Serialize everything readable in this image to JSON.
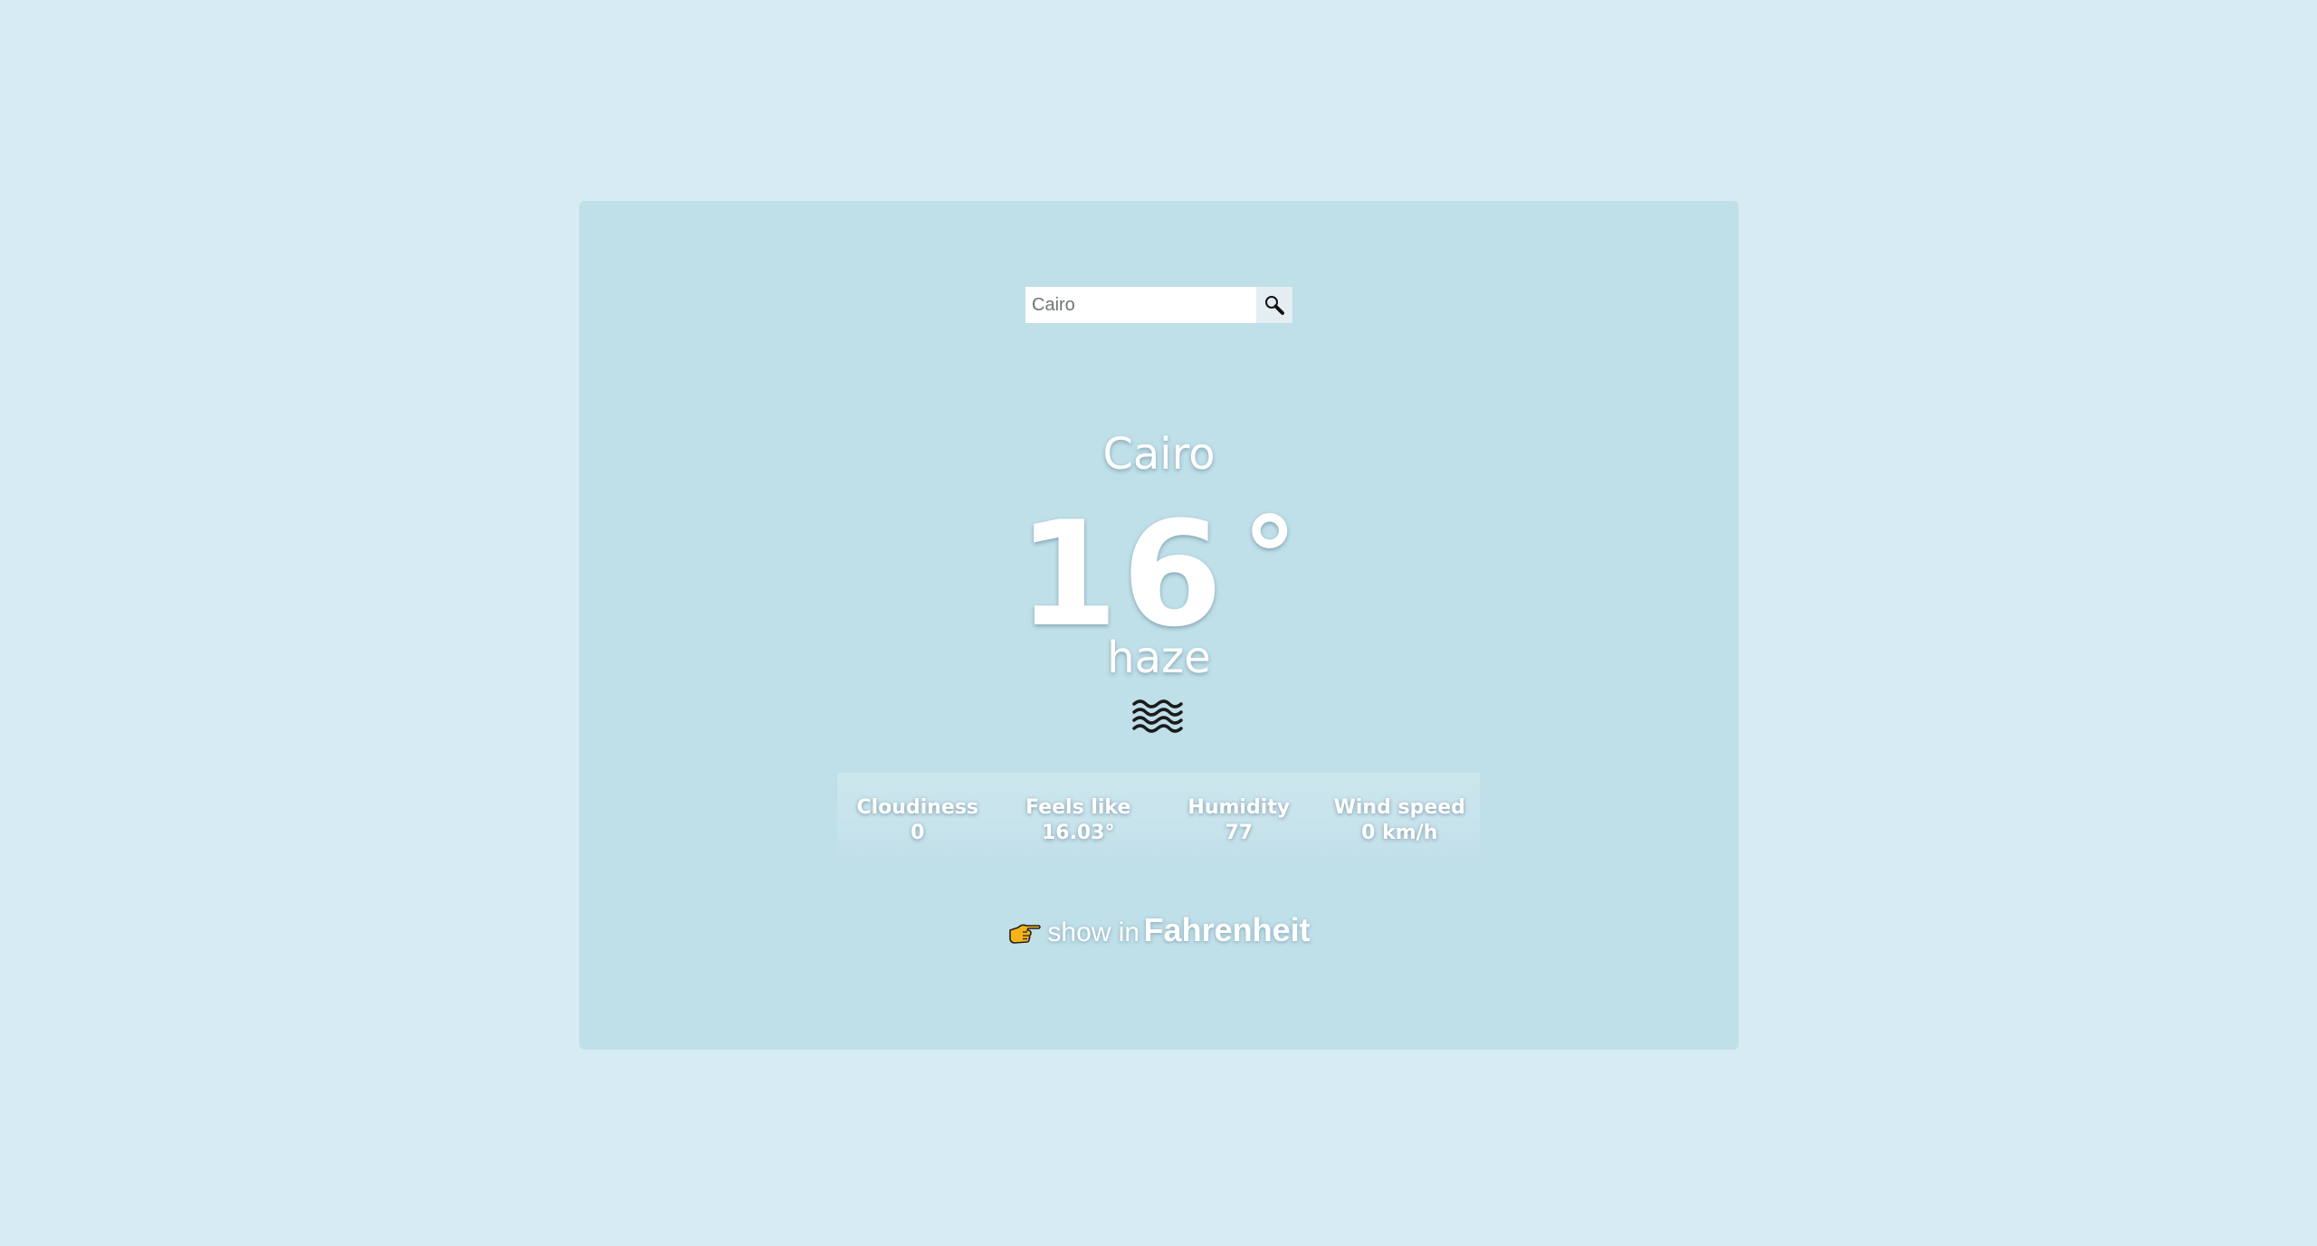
{
  "search": {
    "value": "Cairo",
    "icon": "magnifier-icon"
  },
  "weather": {
    "city": "Cairo",
    "temperature": "16",
    "degree_symbol": "°",
    "condition": "haze",
    "condition_icon": "haze-icon"
  },
  "stats": [
    {
      "label": "Cloudiness",
      "value": "0"
    },
    {
      "label": "Feels like",
      "value": "16.03°"
    },
    {
      "label": "Humidity",
      "value": "77"
    },
    {
      "label": "Wind speed",
      "value": "0 km/h"
    }
  ],
  "unit_toggle": {
    "icon": "pointing-hand-icon",
    "prefix": "show in",
    "unit": "Fahrenheit"
  },
  "colors": {
    "page_background": "#d7ebf2",
    "card_background": "#bfdfe9",
    "text": "#ffffff",
    "hand_fill": "#f5b31a"
  }
}
